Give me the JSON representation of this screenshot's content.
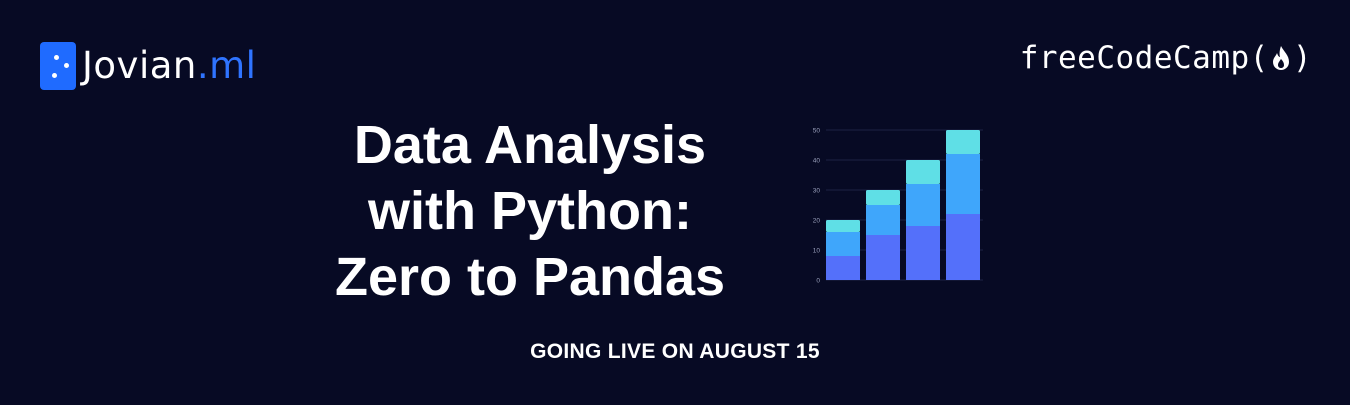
{
  "branding": {
    "jovian_name": "Jovian",
    "jovian_suffix": ".ml",
    "fcc_name": "freeCodeCamp",
    "fcc_open": "(",
    "fcc_close": ")"
  },
  "headline": {
    "lines": [
      "Data Analysis",
      "with Python:",
      "Zero to Pandas"
    ]
  },
  "announcement": "GOING LIVE ON AUGUST 15",
  "colors": {
    "background": "#070a24",
    "accent": "#1f6bff",
    "series": [
      "#5470fa",
      "#3fa6fb",
      "#5fdfe6"
    ]
  },
  "chart_data": {
    "type": "bar",
    "stacked": true,
    "categories": [
      "",
      "",
      "",
      ""
    ],
    "series": [
      {
        "values": [
          8,
          15,
          18,
          22
        ]
      },
      {
        "values": [
          8,
          10,
          14,
          20
        ]
      },
      {
        "values": [
          4,
          5,
          8,
          8
        ]
      }
    ],
    "yticks": [
      0,
      10,
      20,
      30,
      40,
      50
    ],
    "ylim": [
      0,
      50
    ],
    "grid": true
  }
}
